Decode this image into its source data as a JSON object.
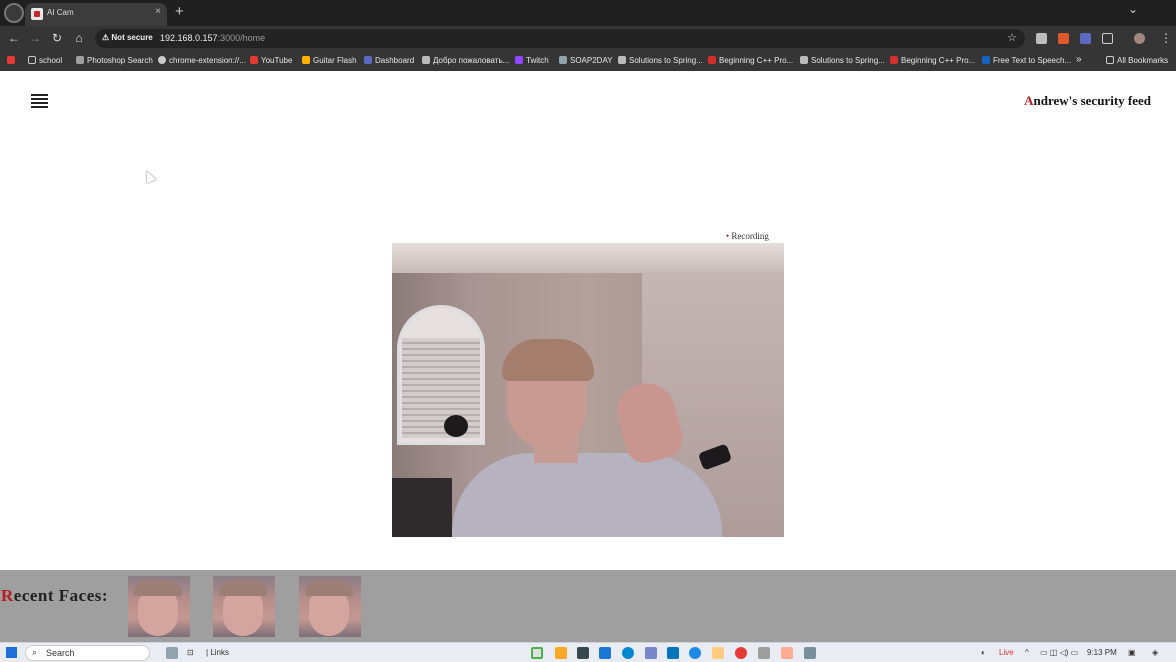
{
  "browser": {
    "tab_title": "AI Cam",
    "tab_close": "×",
    "new_tab": "+",
    "security_label": "Not secure",
    "url_host": "192.168.0.157",
    "url_path": ":3000/home",
    "bookmarks": [
      {
        "label": "school",
        "color": "#cccccc"
      },
      {
        "label": "Photoshop Search",
        "color": "#9e9e9e"
      },
      {
        "label": "chrome-extension://...",
        "color": "#cccccc"
      },
      {
        "label": "YouTube",
        "color": "#e53935"
      },
      {
        "label": "Guitar Flash",
        "color": "#ffb300"
      },
      {
        "label": "Dashboard",
        "color": "#5c6bc0"
      },
      {
        "label": "Добро пожаловать...",
        "color": "#bbbbbb"
      },
      {
        "label": "Twitch",
        "color": "#9146ff"
      },
      {
        "label": "SOAP2DAY",
        "color": "#90a4ae"
      },
      {
        "label": "Solutions to Spring...",
        "color": "#bbbbbb"
      },
      {
        "label": "Beginning C++ Pro...",
        "color": "#d32f2f"
      },
      {
        "label": "Solutions to Spring...",
        "color": "#bbbbbb"
      },
      {
        "label": "Beginning C++ Pro...",
        "color": "#d32f2f"
      },
      {
        "label": "Free Text to Speech...",
        "color": "#1565c0"
      }
    ],
    "overflow": "»",
    "all_bookmarks": "All Bookmarks"
  },
  "page": {
    "title_initial": "A",
    "title_rest": "ndrew's security feed",
    "recording_dot": "•",
    "recording_label": "Recording",
    "faces_initial": "R",
    "faces_rest": "ecent Faces:",
    "recent_faces_count": 3
  },
  "taskbar": {
    "search_label": "Search",
    "links_label": "Links",
    "weather_label": "Live",
    "time": "9:13 PM"
  },
  "colors": {
    "accent": "#b71c1c",
    "faces_bar": "#9f9f9f",
    "browser_dark": "#353535"
  }
}
